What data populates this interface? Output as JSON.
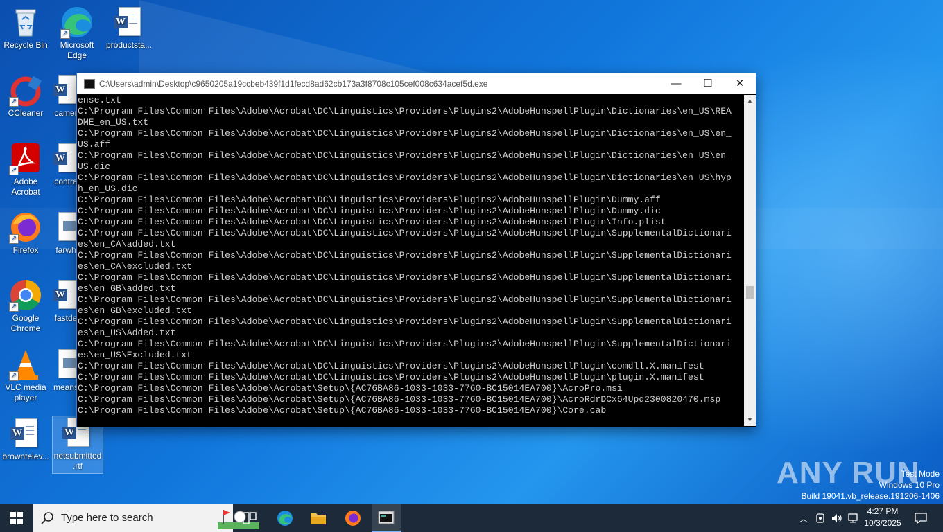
{
  "desktop": {
    "icons": [
      {
        "label": "Recycle Bin",
        "kind": "recycle-bin"
      },
      {
        "label": "Microsoft Edge",
        "kind": "edge"
      },
      {
        "label": "productsta...",
        "kind": "word"
      },
      {
        "label": "CCleaner",
        "kind": "ccleaner"
      },
      {
        "label": "camer",
        "kind": "word"
      },
      {
        "label": "Adobe Acrobat",
        "kind": "acrobat"
      },
      {
        "label": "contra",
        "kind": "word"
      },
      {
        "label": "Firefox",
        "kind": "firefox"
      },
      {
        "label": "farwh",
        "kind": "image"
      },
      {
        "label": "Google Chrome",
        "kind": "chrome"
      },
      {
        "label": "fastde",
        "kind": "word"
      },
      {
        "label": "VLC media player",
        "kind": "vlc"
      },
      {
        "label": "means",
        "kind": "image"
      },
      {
        "label": "browntelev...",
        "kind": "word"
      },
      {
        "label": "netsubmitted .rtf",
        "kind": "word"
      }
    ]
  },
  "cmd_window": {
    "title": "C:\\Users\\admin\\Desktop\\c9650205a19ccbeb439f1d1fecd8ad62cb173a3f8708c105cef008c634acef5d.exe",
    "lines": [
      "ense.txt",
      "C:\\Program Files\\Common Files\\Adobe\\Acrobat\\DC\\Linguistics\\Providers\\Plugins2\\AdobeHunspellPlugin\\Dictionaries\\en_US\\REA",
      "DME_en_US.txt",
      "C:\\Program Files\\Common Files\\Adobe\\Acrobat\\DC\\Linguistics\\Providers\\Plugins2\\AdobeHunspellPlugin\\Dictionaries\\en_US\\en_",
      "US.aff",
      "C:\\Program Files\\Common Files\\Adobe\\Acrobat\\DC\\Linguistics\\Providers\\Plugins2\\AdobeHunspellPlugin\\Dictionaries\\en_US\\en_",
      "US.dic",
      "C:\\Program Files\\Common Files\\Adobe\\Acrobat\\DC\\Linguistics\\Providers\\Plugins2\\AdobeHunspellPlugin\\Dictionaries\\en_US\\hyp",
      "h_en_US.dic",
      "C:\\Program Files\\Common Files\\Adobe\\Acrobat\\DC\\Linguistics\\Providers\\Plugins2\\AdobeHunspellPlugin\\Dummy.aff",
      "C:\\Program Files\\Common Files\\Adobe\\Acrobat\\DC\\Linguistics\\Providers\\Plugins2\\AdobeHunspellPlugin\\Dummy.dic",
      "C:\\Program Files\\Common Files\\Adobe\\Acrobat\\DC\\Linguistics\\Providers\\Plugins2\\AdobeHunspellPlugin\\Info.plist",
      "C:\\Program Files\\Common Files\\Adobe\\Acrobat\\DC\\Linguistics\\Providers\\Plugins2\\AdobeHunspellPlugin\\SupplementalDictionari",
      "es\\en_CA\\added.txt",
      "C:\\Program Files\\Common Files\\Adobe\\Acrobat\\DC\\Linguistics\\Providers\\Plugins2\\AdobeHunspellPlugin\\SupplementalDictionari",
      "es\\en_CA\\excluded.txt",
      "C:\\Program Files\\Common Files\\Adobe\\Acrobat\\DC\\Linguistics\\Providers\\Plugins2\\AdobeHunspellPlugin\\SupplementalDictionari",
      "es\\en_GB\\added.txt",
      "C:\\Program Files\\Common Files\\Adobe\\Acrobat\\DC\\Linguistics\\Providers\\Plugins2\\AdobeHunspellPlugin\\SupplementalDictionari",
      "es\\en_GB\\excluded.txt",
      "C:\\Program Files\\Common Files\\Adobe\\Acrobat\\DC\\Linguistics\\Providers\\Plugins2\\AdobeHunspellPlugin\\SupplementalDictionari",
      "es\\en_US\\Added.txt",
      "C:\\Program Files\\Common Files\\Adobe\\Acrobat\\DC\\Linguistics\\Providers\\Plugins2\\AdobeHunspellPlugin\\SupplementalDictionari",
      "es\\en_US\\Excluded.txt",
      "C:\\Program Files\\Common Files\\Adobe\\Acrobat\\DC\\Linguistics\\Providers\\Plugins2\\AdobeHunspellPlugin\\comdll.X.manifest",
      "C:\\Program Files\\Common Files\\Adobe\\Acrobat\\DC\\Linguistics\\Providers\\Plugins2\\AdobeHunspellPlugin\\plugin.X.manifest",
      "C:\\Program Files\\Common Files\\Adobe\\Acrobat\\Setup\\{AC76BA86-1033-1033-7760-BC15014EA700}\\AcroPro.msi",
      "C:\\Program Files\\Common Files\\Adobe\\Acrobat\\Setup\\{AC76BA86-1033-1033-7760-BC15014EA700}\\AcroRdrDCx64Upd2300820470.msp",
      "C:\\Program Files\\Common Files\\Adobe\\Acrobat\\Setup\\{AC76BA86-1033-1033-7760-BC15014EA700}\\Core.cab"
    ],
    "controls": {
      "minimize": "—",
      "maximize": "☐",
      "close": "✕"
    }
  },
  "watermark": {
    "brand": "ANY RUN",
    "line1": "Test Mode",
    "line2": "Windows 10 Pro",
    "line3": "Build 19041.vb_release.191206-1406"
  },
  "taskbar": {
    "search_placeholder": "Type here to search",
    "apps": [
      "task-view",
      "edge",
      "file-explorer",
      "firefox",
      "cmd"
    ],
    "clock": {
      "time": "4:27 PM",
      "date": "10/3/2025"
    }
  },
  "colors": {
    "console_bg": "#000000",
    "console_text": "#cfcfcf",
    "taskbar": "#1c2a3a",
    "accent": "#3a7bd5"
  }
}
